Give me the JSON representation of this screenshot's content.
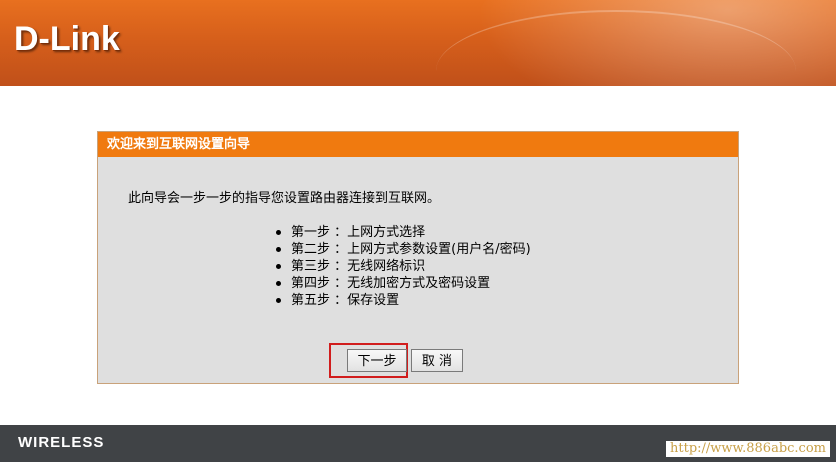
{
  "header": {
    "logo_text": "D-Link"
  },
  "wizard": {
    "title": "欢迎来到互联网设置向导",
    "intro": "此向导会一步一步的指导您设置路由器连接到互联网。",
    "steps": [
      {
        "label": "第一步 ：上网方式选择"
      },
      {
        "label": "第二步 ：上网方式参数设置(用户名/密码)"
      },
      {
        "label": "第三步 ：无线网络标识"
      },
      {
        "label": "第四步 ：无线加密方式及密码设置"
      },
      {
        "label": "第五步 ：保存设置"
      }
    ],
    "next_label": "下一步",
    "cancel_label": "取 消"
  },
  "footer": {
    "brand_text": "WIRELESS"
  },
  "watermark": "http://www.886abc.com",
  "colors": {
    "header_orange": "#d65f1b",
    "panel_title_orange": "#f07a0f",
    "panel_bg": "#dfdfdf",
    "highlight_red": "#d11d1d",
    "footer_bg": "#404346"
  }
}
